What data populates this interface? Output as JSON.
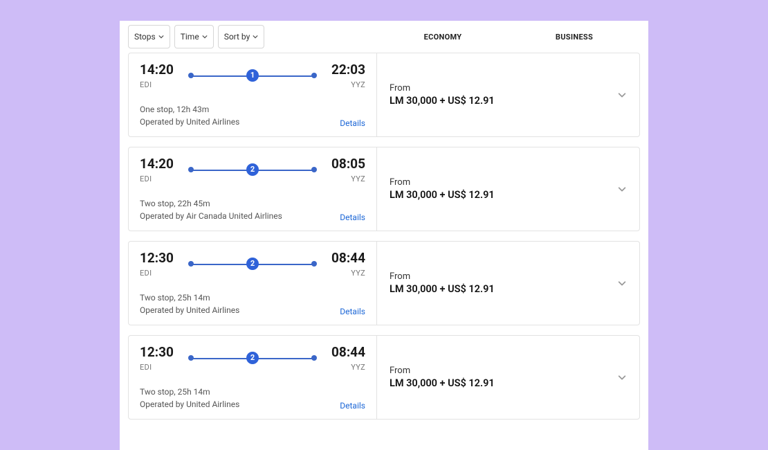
{
  "filters": {
    "stops_label": "Stops",
    "time_label": "Time",
    "sort_label": "Sort by"
  },
  "class_tabs": {
    "economy": "ECONOMY",
    "business": "BUSINESS"
  },
  "common": {
    "from_label": "From",
    "details_label": "Details"
  },
  "flights": [
    {
      "dep_time": "14:20",
      "dep_code": "EDI",
      "arr_time": "22:03",
      "arr_code": "YYZ",
      "stops_badge": "1",
      "stops_desc": "One stop, 12h 43m",
      "operator": "Operated by United Airlines",
      "price": "LM 30,000 + US$ 12.91"
    },
    {
      "dep_time": "14:20",
      "dep_code": "EDI",
      "arr_time": "08:05",
      "arr_code": "YYZ",
      "stops_badge": "2",
      "stops_desc": "Two stop, 22h 45m",
      "operator": "Operated by Air Canada United Airlines",
      "price": "LM 30,000 + US$ 12.91"
    },
    {
      "dep_time": "12:30",
      "dep_code": "EDI",
      "arr_time": "08:44",
      "arr_code": "YYZ",
      "stops_badge": "2",
      "stops_desc": "Two stop, 25h 14m",
      "operator": "Operated by United Airlines",
      "price": "LM 30,000 + US$ 12.91"
    },
    {
      "dep_time": "12:30",
      "dep_code": "EDI",
      "arr_time": "08:44",
      "arr_code": "YYZ",
      "stops_badge": "2",
      "stops_desc": "Two stop, 25h 14m",
      "operator": "Operated by United Airlines",
      "price": "LM 30,000 + US$ 12.91"
    }
  ]
}
